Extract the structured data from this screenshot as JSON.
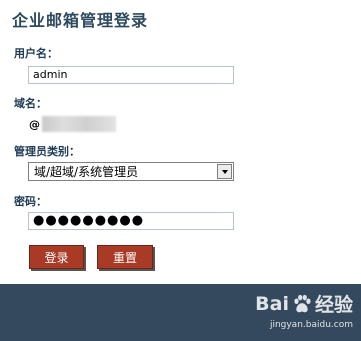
{
  "page": {
    "title": "企业邮箱管理登录"
  },
  "form": {
    "username_label": "用户名：",
    "username_value": "admin",
    "domain_label": "域名：",
    "domain_prefix": "@",
    "admin_type_label": "管理员类别：",
    "admin_type_selected": "域/超域/系统管理员",
    "password_label": "密码：",
    "password_value": "●●●●●●●●●"
  },
  "buttons": {
    "login": "登录",
    "reset": "重置"
  },
  "watermark": {
    "brand_left": "Bai",
    "brand_right": "经验",
    "url": "jingyan.baidu.com"
  },
  "colors": {
    "title": "#2e4a5e",
    "label": "#1f3b55",
    "button_bg": "#a83a26",
    "footer_bg": "#34495e"
  }
}
